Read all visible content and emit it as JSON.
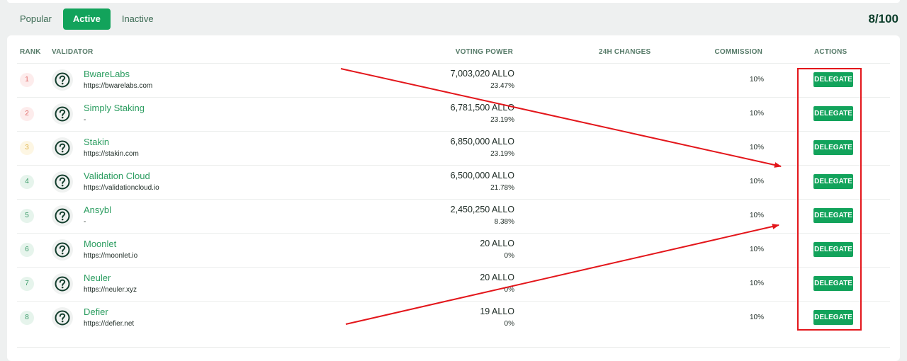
{
  "tabs": [
    {
      "label": "Popular",
      "active": false
    },
    {
      "label": "Active",
      "active": true
    },
    {
      "label": "Inactive",
      "active": false
    }
  ],
  "count": "8/100",
  "table": {
    "headers": {
      "rank": "RANK",
      "validator": "VALIDATOR",
      "voting_power": "VOTING POWER",
      "changes": "24H CHANGES",
      "commission": "COMMISSION",
      "actions": "ACTIONS"
    },
    "rows": [
      {
        "rank": "1",
        "name": "BwareLabs",
        "website": "https://bwarelabs.com",
        "amount": "7,003,020 ALLO",
        "percent": "23.47%",
        "commission": "10%",
        "action": "DELEGATE"
      },
      {
        "rank": "2",
        "name": "Simply Staking",
        "website": "-",
        "amount": "6,781,500 ALLO",
        "percent": "23.19%",
        "commission": "10%",
        "action": "DELEGATE"
      },
      {
        "rank": "3",
        "name": "Stakin",
        "website": "https://stakin.com",
        "amount": "6,850,000 ALLO",
        "percent": "23.19%",
        "commission": "10%",
        "action": "DELEGATE"
      },
      {
        "rank": "4",
        "name": "Validation Cloud",
        "website": "https://validationcloud.io",
        "amount": "6,500,000 ALLO",
        "percent": "21.78%",
        "commission": "10%",
        "action": "DELEGATE"
      },
      {
        "rank": "5",
        "name": "Ansybl",
        "website": "-",
        "amount": "2,450,250 ALLO",
        "percent": "8.38%",
        "commission": "10%",
        "action": "DELEGATE"
      },
      {
        "rank": "6",
        "name": "Moonlet",
        "website": "https://moonlet.io",
        "amount": "20 ALLO",
        "percent": "0%",
        "commission": "10%",
        "action": "DELEGATE"
      },
      {
        "rank": "7",
        "name": "Neuler",
        "website": "https://neuler.xyz",
        "amount": "20 ALLO",
        "percent": "0%",
        "commission": "10%",
        "action": "DELEGATE"
      },
      {
        "rank": "8",
        "name": "Defier",
        "website": "https://defier.net",
        "amount": "19 ALLO",
        "percent": "0%",
        "commission": "10%",
        "action": "DELEGATE"
      }
    ]
  },
  "colors": {
    "accent": "#12a35b",
    "annotation": "#e3161b",
    "rank_top1_bg": "#fdecec",
    "rank_top1_fg": "#e06a6a",
    "rank_top2_bg": "#fdecec",
    "rank_top2_fg": "#e06a6a",
    "rank_top3_bg": "#fdf6e3",
    "rank_top3_fg": "#e0b44a",
    "rank_default_bg": "#e6f4ec",
    "rank_default_fg": "#3a9a68"
  },
  "icons": {
    "validator_avatar": "question-circle-icon"
  }
}
